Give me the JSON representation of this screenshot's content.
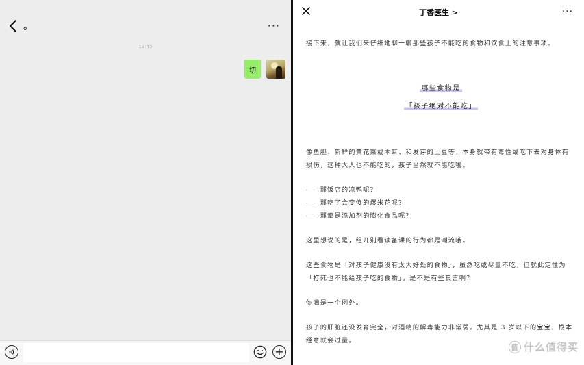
{
  "chat": {
    "title": "。",
    "more_label": "···",
    "timestamp": "13:45",
    "message": "切",
    "input_placeholder": ""
  },
  "article": {
    "title": "丁香医生 >",
    "more_label": "···",
    "intro": "接下来，就让我们来仔细地聊一聊那些孩子不能吃的食物和饮食上的注意事项。",
    "heading_line1": "哪些食物是",
    "heading_line2": "「孩子绝对不能吃」",
    "para1": "像鱼胆、新鲜的黄花菜或木耳、和发芽的土豆等，本身就带有毒性或吃下去对身体有损伤，这种大人也不能吃的，孩子当然就不能吃啦。",
    "q1": "——那饭店的凉鸭呢？",
    "q2": "——那吃了会变傻的爆米花呢？",
    "q3": "——那都是添加剂的膨化食品呢？",
    "para2": "这里想说的是，组开别看读备课的行为都是潮流哦。",
    "para3": "这些食物是「对孩子健康没有太大好处的食物」，虽然吃或尽量不吃，但就此定性为「打死也不能给孩子吃的食物」，是不是有些良言啊？",
    "para4": "你滴是一个例外。",
    "para5": "孩子的肝脏还没发育完全，对酒精的解毒能力非常弱。尤其是 3 岁以下的宝宝，根本经意就会过量。"
  },
  "watermark": {
    "badge": "值",
    "text": "什么值得买"
  }
}
